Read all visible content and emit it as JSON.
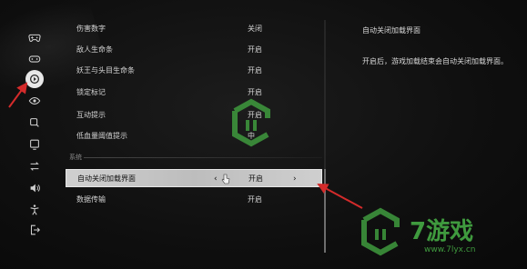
{
  "sidebar": {
    "items": [
      {
        "icon": "gamepad-icon"
      },
      {
        "icon": "controller-alt-icon"
      },
      {
        "icon": "display-settings-icon",
        "active": true
      },
      {
        "icon": "eye-icon"
      },
      {
        "icon": "search-icon"
      },
      {
        "icon": "monitor-icon"
      },
      {
        "icon": "swap-icon"
      },
      {
        "icon": "speaker-icon"
      },
      {
        "icon": "accessibility-icon"
      },
      {
        "icon": "exit-icon"
      }
    ]
  },
  "settings": {
    "rows": [
      {
        "label": "伤害数字",
        "value": "关闭"
      },
      {
        "label": "敌人生命条",
        "value": "开启"
      },
      {
        "label": "妖王与头目生命条",
        "value": "开启"
      },
      {
        "label": "锁定标记",
        "value": "开启"
      },
      {
        "label": "互动提示",
        "value": "开启"
      },
      {
        "label": "低血量阈值提示",
        "value": "中"
      }
    ],
    "section_title": "系统",
    "system_rows": [
      {
        "label": "自动关闭加载界面",
        "value": "开启",
        "selected": true,
        "left_arrow": "‹",
        "right_arrow": "›"
      },
      {
        "label": "数据传输",
        "value": "开启"
      }
    ]
  },
  "description": {
    "title": "自动关闭加载界面",
    "body": "开启后，游戏加载结束会自动关闭加载界面。"
  },
  "watermark": {
    "brand": "7游戏",
    "url": "www.7lyx.cn"
  },
  "colors": {
    "annotation": "#d42b2b",
    "watermark": "#3f9a3e",
    "selected_row": "#c8c8c8"
  }
}
